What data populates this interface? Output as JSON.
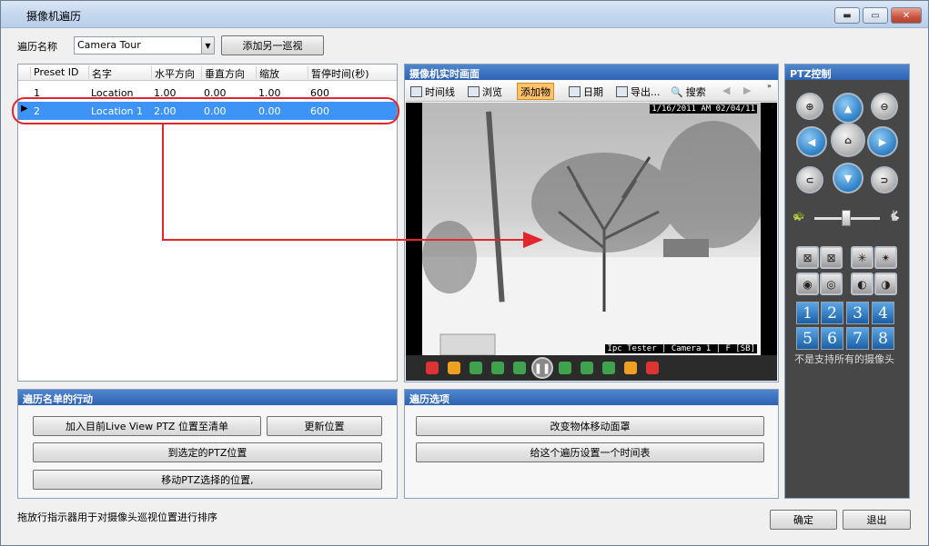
{
  "window": {
    "title": "摄像机遍历",
    "min_label": "▬",
    "max_label": "▭",
    "close_label": "✕"
  },
  "tour": {
    "name_label": "遍历名称",
    "name_value": "Camera Tour",
    "add_button": "添加另一巡视"
  },
  "grid": {
    "columns": [
      "Preset ID",
      "名字",
      "水平方向",
      "垂直方向",
      "缩放",
      "暂停时间(秒)"
    ],
    "rows": [
      [
        "1",
        "Location",
        "1.00",
        "0.00",
        "1.00",
        "600"
      ],
      [
        "2",
        "Location 1",
        "2.00",
        "0.00",
        "0.00",
        "600"
      ]
    ]
  },
  "live": {
    "title": "摄像机实时画面",
    "toolbar": [
      "时间线",
      "浏览",
      "添加物",
      "日期",
      "导出...",
      "搜索"
    ],
    "timestamp": "1/16/2011 AM 02/04/11",
    "camera_label": "Ipc Tester | Camera 1 | F [SB]"
  },
  "ptz": {
    "title": "PTZ控制",
    "numbers": [
      "1",
      "2",
      "3",
      "4",
      "5",
      "6",
      "7",
      "8"
    ],
    "note": "不是支持所有的摄像头"
  },
  "tour_actions": {
    "title": "遍历名单的行动",
    "add_current": "加入目前Live View PTZ 位置至清单",
    "update": "更新位置",
    "goto": "到选定的PTZ位置",
    "move": "移动PTZ选择的位置,"
  },
  "tour_options": {
    "title": "遍历选项",
    "mask": "改变物体移动面罩",
    "schedule": "给这个遍历设置一个时间表"
  },
  "footer": {
    "hint": "拖放行指示器用于对摄像头巡视位置进行排序",
    "ok": "确定",
    "exit": "退出"
  }
}
